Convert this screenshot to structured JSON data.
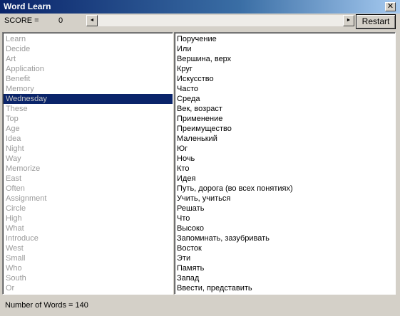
{
  "window": {
    "title": "Word Learn",
    "close_glyph": "✕"
  },
  "toolbar": {
    "score_label": "SCORE =",
    "score_value": "0",
    "scroll_left_icon": "◄",
    "scroll_right_icon": "►",
    "restart_label": "Restart"
  },
  "english_words": [
    "Learn",
    "Decide",
    "Art",
    "Application",
    "Benefit",
    "Memory",
    "Wednesday",
    "These",
    "Top",
    "Age",
    "Idea",
    "Night",
    "Way",
    "Memorize",
    "East",
    "Often",
    "Assignment",
    "Circle",
    "High",
    "What",
    "Introduce",
    "West",
    "Small",
    "Who",
    "South",
    "Or"
  ],
  "selected_index": 6,
  "russian_words": [
    "Поручение",
    "Или",
    "Вершина, верх",
    "Круг",
    "Искусство",
    "Часто",
    "Среда",
    "Век, возраст",
    "Применение",
    "Преимущество",
    "Маленький",
    "Юг",
    "Ночь",
    "Кто",
    "Идея",
    "Путь, дорога (во всех понятиях)",
    "Учить, учиться",
    "Решать",
    "Что",
    "Высоко",
    "Запоминать, зазубривать",
    "Восток",
    "Эти",
    "Память",
    "Запад",
    "Ввести, представить"
  ],
  "status": {
    "word_count_text": "Number of Words = 140"
  },
  "colors": {
    "selection": "#0a246a",
    "inactive_text": "#9a9a9a",
    "face": "#d4d0c8"
  }
}
